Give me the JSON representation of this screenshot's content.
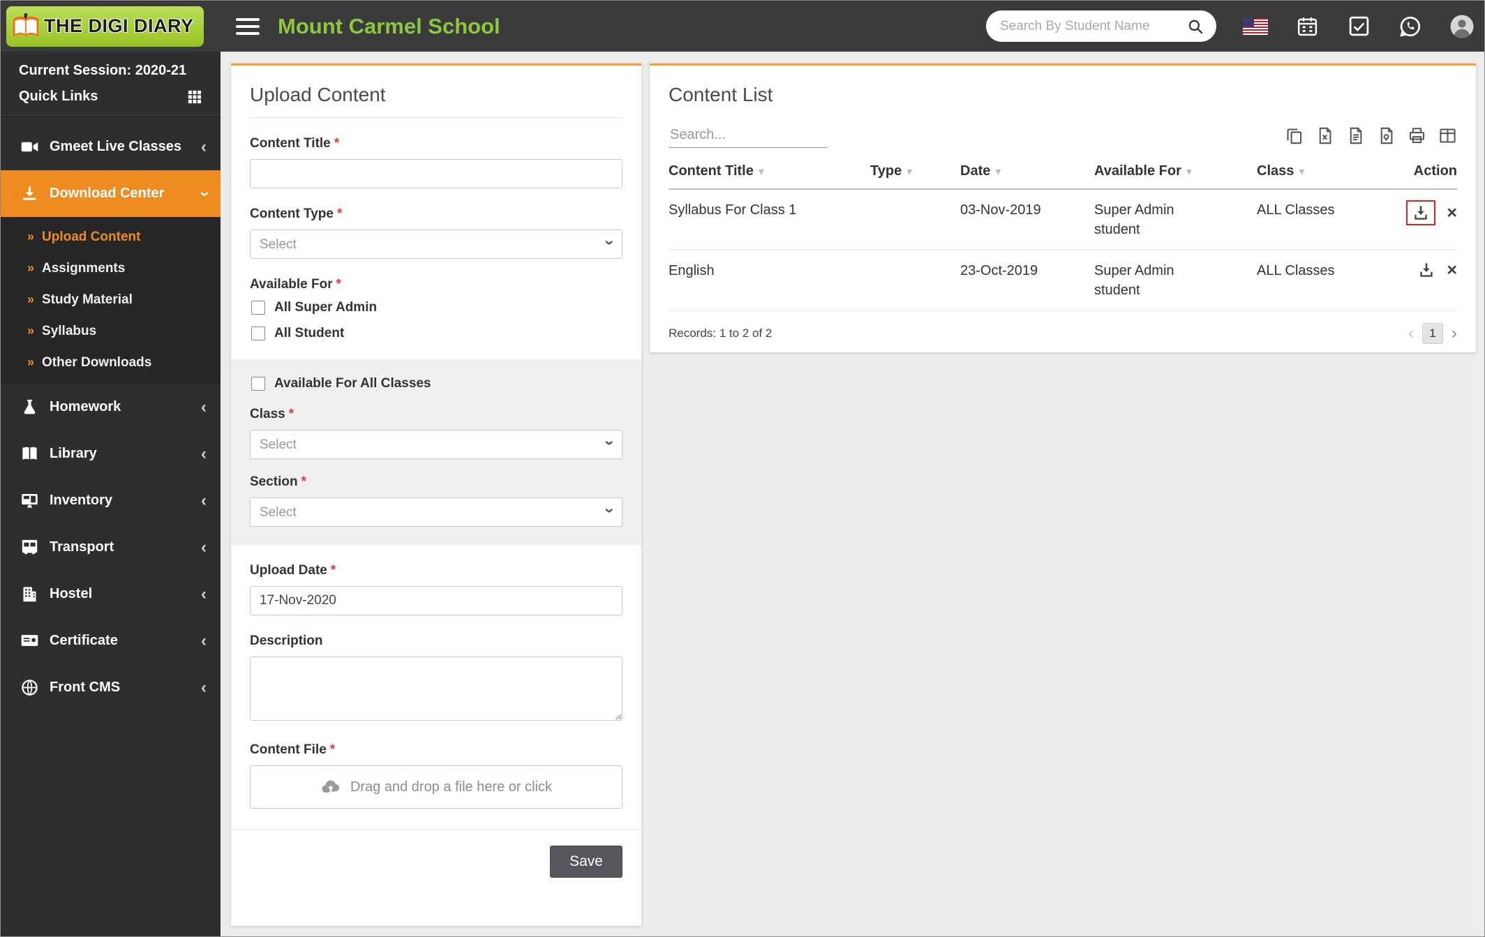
{
  "colors": {
    "orange": "#ef8c21",
    "green": "#8dc63f",
    "lime": "#a6ce39",
    "red_highlight": "#e02020"
  },
  "header": {
    "logo_text": "THE DIGI DIARY",
    "school_name": "Mount Carmel School",
    "search": {
      "placeholder": "Search By Student Name"
    }
  },
  "sidebar": {
    "session": "Current Session: 2020-21",
    "quick_links": "Quick Links",
    "items": [
      {
        "label": "Gmeet Live Classes",
        "icon": "video-icon",
        "chevron": "left"
      },
      {
        "label": "Download Center",
        "icon": "download-icon",
        "chevron": "down",
        "active": true
      },
      {
        "label": "Homework",
        "icon": "flask-icon",
        "chevron": "left"
      },
      {
        "label": "Library",
        "icon": "book-icon",
        "chevron": "left"
      },
      {
        "label": "Inventory",
        "icon": "monitor-icon",
        "chevron": "left"
      },
      {
        "label": "Transport",
        "icon": "bus-icon",
        "chevron": "left"
      },
      {
        "label": "Hostel",
        "icon": "building-icon",
        "chevron": "left"
      },
      {
        "label": "Certificate",
        "icon": "certificate-icon",
        "chevron": "left"
      },
      {
        "label": "Front CMS",
        "icon": "globe-icon",
        "chevron": "left"
      }
    ],
    "download_center_submenu": [
      {
        "label": "Upload Content",
        "active": true
      },
      {
        "label": "Assignments",
        "active": false
      },
      {
        "label": "Study Material",
        "active": false
      },
      {
        "label": "Syllabus",
        "active": false
      },
      {
        "label": "Other Downloads",
        "active": false
      }
    ]
  },
  "upload_form": {
    "title": "Upload Content",
    "required_marker": "*",
    "content_title_label": "Content Title",
    "content_type_label": "Content Type",
    "select_placeholder": "Select",
    "available_for_label": "Available For",
    "all_super_admin_label": "All Super Admin",
    "all_student_label": "All Student",
    "all_classes_label": "Available For All Classes",
    "class_label": "Class",
    "section_label": "Section",
    "upload_date_label": "Upload Date",
    "upload_date_value": "17-Nov-2020",
    "description_label": "Description",
    "content_file_label": "Content File",
    "dropzone_text": "Drag and drop a file here or click",
    "save_label": "Save"
  },
  "content_list": {
    "title": "Content List",
    "search_placeholder": "Search...",
    "export_icons": [
      "copy-icon",
      "excel-icon",
      "csv-icon",
      "pdf-icon",
      "print-icon",
      "columns-icon"
    ],
    "columns": [
      {
        "label": "Content Title",
        "sortable": true
      },
      {
        "label": "Type",
        "sortable": true
      },
      {
        "label": "Date",
        "sortable": true
      },
      {
        "label": "Available For",
        "sortable": true
      },
      {
        "label": "Class",
        "sortable": true
      },
      {
        "label": "Action",
        "sortable": false
      }
    ],
    "rows": [
      {
        "content_title": "Syllabus For Class 1",
        "type": "",
        "date": "03-Nov-2019",
        "available_for_line1": "Super Admin",
        "available_for_line2": "student",
        "class": "ALL Classes",
        "download_highlighted": true
      },
      {
        "content_title": "English",
        "type": "",
        "date": "23-Oct-2019",
        "available_for_line1": "Super Admin",
        "available_for_line2": "student",
        "class": "ALL Classes",
        "download_highlighted": false
      }
    ],
    "records_text": "Records: 1 to 2 of 2",
    "pagination": {
      "prev": "‹",
      "page": "1",
      "next": "›"
    }
  }
}
